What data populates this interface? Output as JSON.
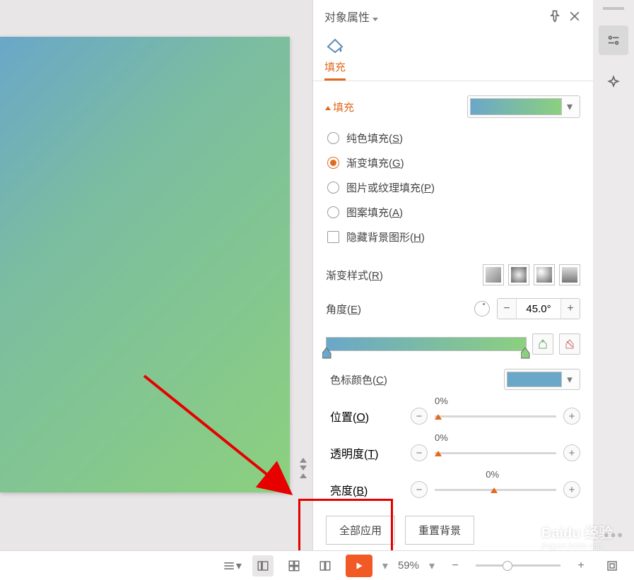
{
  "panel": {
    "title": "对象属性",
    "tab_label": "填充",
    "section_title": "填充"
  },
  "fill_options": {
    "solid": "纯色填充(S)",
    "gradient": "渐变填充(G)",
    "picture": "图片或纹理填充(P)",
    "pattern": "图案填充(A)",
    "hide_bg": "隐藏背景图形(H)"
  },
  "controls": {
    "style_label": "渐变样式(R)",
    "angle_label": "角度(E)",
    "angle_value": "45.0°",
    "stop_color_label": "色标颜色(C)",
    "position_label": "位置(O)",
    "position_value": "0%",
    "transparency_label": "透明度(T)",
    "transparency_value": "0%",
    "brightness_label": "亮度(B)",
    "brightness_value": "0%"
  },
  "buttons": {
    "apply_all": "全部应用",
    "reset_bg": "重置背景"
  },
  "status": {
    "zoom": "59%"
  },
  "watermark": {
    "brand": "Baidu 经验",
    "url": "jingyan.baidu.com"
  }
}
